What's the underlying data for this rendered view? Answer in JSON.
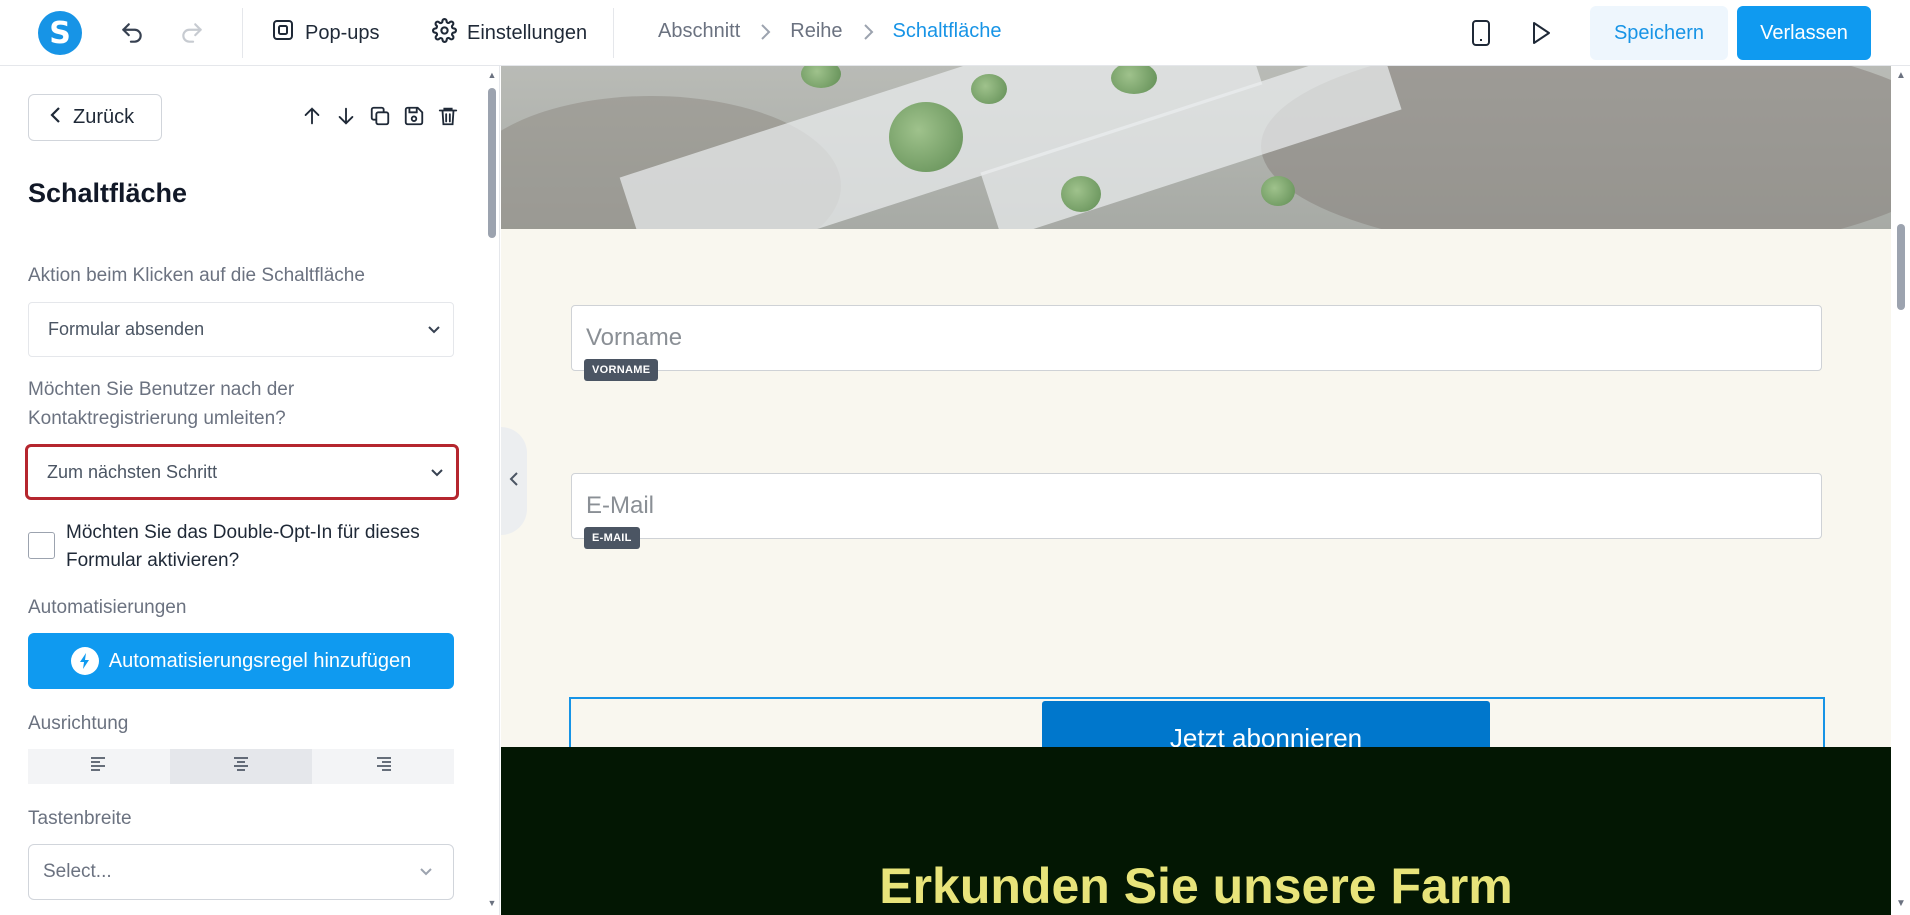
{
  "topbar": {
    "logo_letter": "S",
    "popups_label": "Pop-ups",
    "settings_label": "Einstellungen",
    "breadcrumbs": [
      "Abschnitt",
      "Reihe",
      "Schaltfläche"
    ],
    "save_label": "Speichern",
    "exit_label": "Verlassen"
  },
  "panel": {
    "back_label": "Zurück",
    "title": "Schaltfläche",
    "action_label": "Aktion beim Klicken auf die Schaltfläche",
    "action_value": "Formular absenden",
    "redirect_label": "Möchten Sie Benutzer nach der Kontaktregistrierung umleiten?",
    "redirect_value": "Zum nächsten Schritt",
    "double_optin_label": "Möchten Sie das Double-Opt-In für dieses Formular aktivieren?",
    "automations_label": "Automatisierungen",
    "add_rule_label": "Automatisierungsregel hinzufügen",
    "alignment_label": "Ausrichtung",
    "button_width_label": "Tastenbreite",
    "button_width_placeholder": "Select..."
  },
  "canvas": {
    "firstname_placeholder": "Vorname",
    "firstname_tag": "VORNAME",
    "email_placeholder": "E-Mail",
    "email_tag": "E-MAIL",
    "subscribe_label": "Jetzt abonnieren",
    "section_title": "Erkunden Sie unsere Farm"
  },
  "colors": {
    "accent": "#1794e6",
    "highlight": "#b5262e",
    "subscribe_button": "#0077cc",
    "dark_section": "#031703",
    "dark_title": "#e8e47a"
  }
}
